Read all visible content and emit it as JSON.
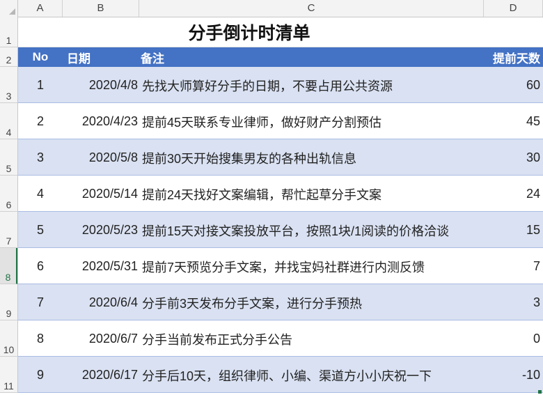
{
  "columns": [
    "A",
    "B",
    "C",
    "D"
  ],
  "row_numbers": [
    "1",
    "2",
    "3",
    "4",
    "5",
    "6",
    "7",
    "8",
    "9",
    "10",
    "11"
  ],
  "active_row": "8",
  "title": "分手倒计时清单",
  "headers": {
    "no": "No",
    "date": "日期",
    "note": "备注",
    "days": "提前天数"
  },
  "rows": [
    {
      "no": "1",
      "date": "2020/4/8",
      "note": "先找大师算好分手的日期，不要占用公共资源",
      "days": "60"
    },
    {
      "no": "2",
      "date": "2020/4/23",
      "note": "提前45天联系专业律师，做好财产分割预估",
      "days": "45"
    },
    {
      "no": "3",
      "date": "2020/5/8",
      "note": "提前30天开始搜集男友的各种出轨信息",
      "days": "30"
    },
    {
      "no": "4",
      "date": "2020/5/14",
      "note": "提前24天找好文案编辑，帮忙起草分手文案",
      "days": "24"
    },
    {
      "no": "5",
      "date": "2020/5/23",
      "note": "提前15天对接文案投放平台，按照1块/1阅读的价格洽谈",
      "days": "15"
    },
    {
      "no": "6",
      "date": "2020/5/31",
      "note": "提前7天预览分手文案，并找宝妈社群进行内测反馈",
      "days": "7"
    },
    {
      "no": "7",
      "date": "2020/6/4",
      "note": "分手前3天发布分手文案，进行分手预热",
      "days": "3"
    },
    {
      "no": "8",
      "date": "2020/6/7",
      "note": "分手当前发布正式分手公告",
      "days": "0"
    },
    {
      "no": "9",
      "date": "2020/6/17",
      "note": "分手后10天，组织律师、小编、渠道方小小庆祝一下",
      "days": "-10"
    }
  ],
  "colors": {
    "header_fill": "#4472c4",
    "band_fill": "#d9e1f2",
    "row_border": "#a9bce3",
    "selection": "#217346"
  }
}
